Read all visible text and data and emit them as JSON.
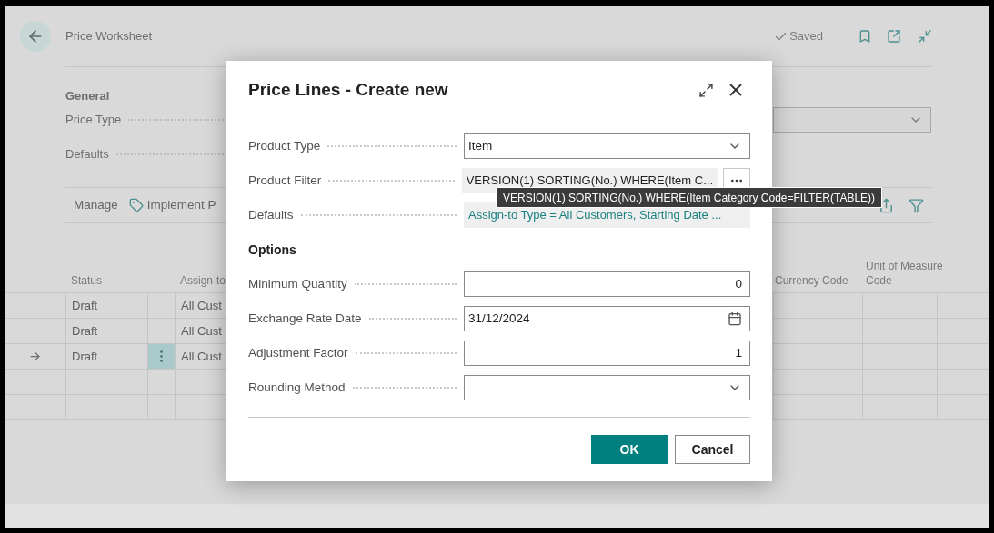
{
  "page": {
    "title": "Price Worksheet",
    "status": "Saved",
    "general": {
      "heading": "General",
      "fields": [
        {
          "label": "Price Type",
          "kind": "select"
        },
        {
          "label": "Defaults",
          "kind": "text"
        }
      ]
    },
    "actions": [
      {
        "label": "Manage",
        "kind": "menu"
      },
      {
        "label": "Implement P",
        "kind": "icon"
      }
    ],
    "table": {
      "columns": [
        {
          "label": "Status"
        },
        {
          "label": "Assign-to"
        },
        {
          "label": "Currency Code"
        },
        {
          "label": "Unit of Measure Code"
        }
      ],
      "rows": [
        {
          "status": "Draft",
          "assign_to": "All Cust",
          "current": false
        },
        {
          "status": "Draft",
          "assign_to": "All Cust",
          "current": false
        },
        {
          "status": "Draft",
          "assign_to": "All Cust",
          "current": true
        }
      ]
    }
  },
  "dialog": {
    "title": "Price Lines - Create new",
    "fields": [
      {
        "label": "Product Type",
        "kind": "select",
        "value": "Item"
      },
      {
        "label": "Product Filter",
        "kind": "lookup",
        "value": "VERSION(1) SORTING(No.) WHERE(Item C..."
      },
      {
        "label": "Defaults",
        "kind": "link",
        "value": "Assign-to Type = All Customers, Starting Date ..."
      }
    ],
    "options_heading": "Options",
    "options": [
      {
        "label": "Minimum Quantity",
        "kind": "number",
        "value": "0"
      },
      {
        "label": "Exchange Rate Date",
        "kind": "date",
        "value": "31/12/2024"
      },
      {
        "label": "Adjustment Factor",
        "kind": "number",
        "value": "1"
      },
      {
        "label": "Rounding Method",
        "kind": "select"
      }
    ],
    "buttons": [
      {
        "label": "OK",
        "kind": "primary"
      },
      {
        "label": "Cancel",
        "kind": "secondary"
      }
    ]
  },
  "tooltip": "VERSION(1) SORTING(No.) WHERE(Item Category Code=FILTER(TABLE))"
}
